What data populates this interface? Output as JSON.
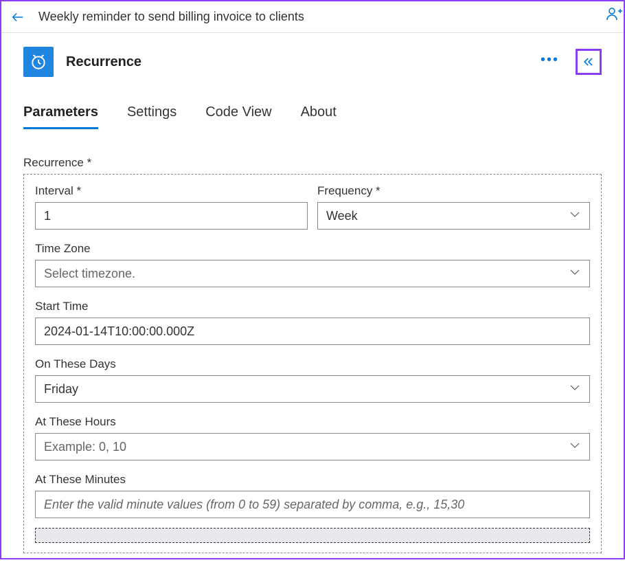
{
  "header": {
    "title": "Weekly reminder to send billing invoice to clients"
  },
  "card": {
    "title": "Recurrence"
  },
  "tabs": [
    {
      "label": "Parameters",
      "active": true
    },
    {
      "label": "Settings",
      "active": false
    },
    {
      "label": "Code View",
      "active": false
    },
    {
      "label": "About",
      "active": false
    }
  ],
  "section": {
    "label": "Recurrence *"
  },
  "fields": {
    "interval": {
      "label": "Interval *",
      "value": "1"
    },
    "frequency": {
      "label": "Frequency *",
      "value": "Week"
    },
    "timezone": {
      "label": "Time Zone",
      "placeholder": "Select timezone."
    },
    "starttime": {
      "label": "Start Time",
      "value": "2024-01-14T10:00:00.000Z"
    },
    "days": {
      "label": "On These Days",
      "value": "Friday"
    },
    "hours": {
      "label": "At These Hours",
      "placeholder": "Example: 0, 10"
    },
    "minutes": {
      "label": "At These Minutes",
      "placeholder": "Enter the valid minute values (from 0 to 59) separated by comma, e.g., 15,30"
    }
  }
}
